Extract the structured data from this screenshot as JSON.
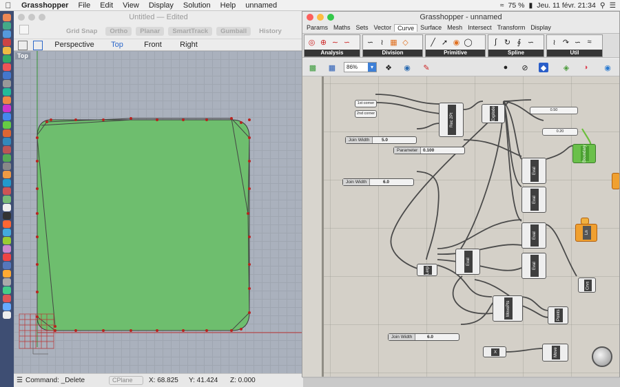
{
  "menubar": {
    "app": "Grasshopper",
    "items": [
      "File",
      "Edit",
      "View",
      "Display",
      "Solution",
      "Help",
      "unnamed"
    ],
    "battery": "75 %",
    "datetime": "Jeu. 11 févr. 21:34"
  },
  "rhino": {
    "title": "Untitled",
    "title_suffix": "— Edited",
    "snaps": [
      "Grid Snap",
      "Ortho",
      "Planar",
      "SmartTrack",
      "Gumball",
      "History"
    ],
    "tabs": [
      "Perspective",
      "Top",
      "Front",
      "Right"
    ],
    "active_tab": "Top",
    "viewport_label": "Top",
    "command": "Command: _Delete",
    "cplane": "CPlane",
    "x": "X: 68.825",
    "y": "Y: 41.424",
    "z": "Z: 0.000",
    "shape_fill": "#6ebe6e"
  },
  "grasshopper": {
    "title": "Grasshopper - unnamed",
    "tabs": [
      "Params",
      "Maths",
      "Sets",
      "Vector",
      "Curve",
      "Surface",
      "Mesh",
      "Intersect",
      "Transform",
      "Display"
    ],
    "active_tab": "Curve",
    "groups": [
      "Analysis",
      "Division",
      "Primitive",
      "Spline",
      "Util"
    ],
    "zoom": "86%",
    "panels": {
      "p1": "1st corner",
      "p2": "2nd corner",
      "v1": "0.50",
      "v2": "0.20"
    },
    "sliders": [
      {
        "name": "Join Width",
        "value": "5.0"
      },
      {
        "name": "Parameter",
        "value": "0.100"
      },
      {
        "name": "Join Width",
        "value": "6.0"
      },
      {
        "name": "Join Width",
        "value": "6.0"
      }
    ],
    "components": {
      "rec": "Rec 2Pt",
      "explode": "Explode",
      "eval": "Eval",
      "lerp": "Lerp",
      "boundary": "Boundary",
      "ln": "Ln",
      "crvs": "Crvs",
      "points": "Points",
      "movepts": "MovePts",
      "move": "Move",
      "x": "X"
    }
  }
}
